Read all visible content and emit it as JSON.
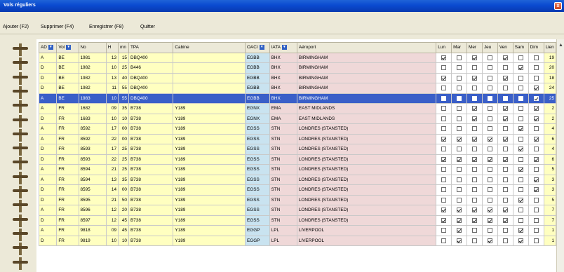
{
  "window": {
    "title": "Vols réguliers",
    "close_label": "x"
  },
  "menu": [
    {
      "label": "Ajouter (F2)"
    },
    {
      "label": "Supprimer (F4)"
    },
    {
      "label": "Enregistrer (F8)"
    },
    {
      "label": "Quitter"
    }
  ],
  "columns": {
    "ad": "AD",
    "vol": "Vol",
    "no": "No",
    "h": "H",
    "mn": "mn",
    "tpa": "TPA",
    "cabine": "Cabine",
    "oaci": "OACI",
    "iata": "IATA",
    "aeroport": "Aéroport",
    "lun": "Lun",
    "mar": "Mar",
    "mer": "Mer",
    "jeu": "Jeu",
    "ven": "Ven",
    "sam": "Sam",
    "dim": "Dim",
    "lien": "Lien"
  },
  "scroll_up_icon": "▲",
  "rows": [
    {
      "ad": "A",
      "vol": "BE",
      "no": "1981",
      "h": "13",
      "mn": "15",
      "tpa": "DBQ400",
      "cabine": "",
      "oaci": "EGBB",
      "iata": "BHX",
      "aeroport": "BIRMINGHAM",
      "days": [
        1,
        0,
        1,
        0,
        1,
        0,
        0
      ],
      "lien": "19",
      "selected": false
    },
    {
      "ad": "D",
      "vol": "BE",
      "no": "1982",
      "h": "10",
      "mn": "25",
      "tpa": "B446",
      "cabine": "",
      "oaci": "EGBB",
      "iata": "BHX",
      "aeroport": "BIRMINGHAM",
      "days": [
        0,
        0,
        0,
        0,
        0,
        1,
        0
      ],
      "lien": "20",
      "selected": false
    },
    {
      "ad": "D",
      "vol": "BE",
      "no": "1982",
      "h": "13",
      "mn": "40",
      "tpa": "DBQ400",
      "cabine": "",
      "oaci": "EGBB",
      "iata": "BHX",
      "aeroport": "BIRMINGHAM",
      "days": [
        1,
        0,
        1,
        0,
        1,
        0,
        0
      ],
      "lien": "18",
      "selected": false
    },
    {
      "ad": "D",
      "vol": "BE",
      "no": "1982",
      "h": "11",
      "mn": "55",
      "tpa": "DBQ400",
      "cabine": "",
      "oaci": "EGBB",
      "iata": "BHX",
      "aeroport": "BIRMINGHAM",
      "days": [
        0,
        0,
        0,
        0,
        0,
        0,
        1
      ],
      "lien": "24",
      "selected": false
    },
    {
      "ad": "A",
      "vol": "BE",
      "no": "1983",
      "h": "10",
      "mn": "55",
      "tpa": "DBQ400",
      "cabine": "",
      "oaci": "EGBB",
      "iata": "BHX",
      "aeroport": "BIRMINGHAM",
      "days": [
        0,
        0,
        0,
        0,
        0,
        0,
        1
      ],
      "lien": "25",
      "selected": true
    },
    {
      "ad": "A",
      "vol": "FR",
      "no": "1682",
      "h": "09",
      "mn": "35",
      "tpa": "B738",
      "cabine": "Y189",
      "oaci": "EGNX",
      "iata": "EMA",
      "aeroport": "EAST MIDLANDS",
      "days": [
        0,
        0,
        1,
        0,
        1,
        0,
        1
      ],
      "lien": "2",
      "selected": false
    },
    {
      "ad": "D",
      "vol": "FR",
      "no": "1683",
      "h": "10",
      "mn": "10",
      "tpa": "B738",
      "cabine": "Y189",
      "oaci": "EGNX",
      "iata": "EMA",
      "aeroport": "EAST MIDLANDS",
      "days": [
        0,
        0,
        1,
        0,
        1,
        0,
        1
      ],
      "lien": "2",
      "selected": false
    },
    {
      "ad": "A",
      "vol": "FR",
      "no": "8592",
      "h": "17",
      "mn": "00",
      "tpa": "B738",
      "cabine": "Y189",
      "oaci": "EGSS",
      "iata": "STN",
      "aeroport": "LONDRES (STANSTED)",
      "days": [
        0,
        0,
        0,
        0,
        0,
        1,
        0
      ],
      "lien": "4",
      "selected": false
    },
    {
      "ad": "A",
      "vol": "FR",
      "no": "8592",
      "h": "22",
      "mn": "00",
      "tpa": "B738",
      "cabine": "Y189",
      "oaci": "EGSS",
      "iata": "STN",
      "aeroport": "LONDRES (STANSTED)",
      "days": [
        1,
        1,
        1,
        1,
        1,
        0,
        1
      ],
      "lien": "6",
      "selected": false
    },
    {
      "ad": "D",
      "vol": "FR",
      "no": "8593",
      "h": "17",
      "mn": "25",
      "tpa": "B738",
      "cabine": "Y189",
      "oaci": "EGSS",
      "iata": "STN",
      "aeroport": "LONDRES (STANSTED)",
      "days": [
        0,
        0,
        0,
        0,
        0,
        1,
        0
      ],
      "lien": "4",
      "selected": false
    },
    {
      "ad": "D",
      "vol": "FR",
      "no": "8593",
      "h": "22",
      "mn": "25",
      "tpa": "B738",
      "cabine": "Y189",
      "oaci": "EGSS",
      "iata": "STN",
      "aeroport": "LONDRES (STANSTED)",
      "days": [
        1,
        1,
        1,
        1,
        1,
        0,
        1
      ],
      "lien": "6",
      "selected": false
    },
    {
      "ad": "A",
      "vol": "FR",
      "no": "8594",
      "h": "21",
      "mn": "25",
      "tpa": "B738",
      "cabine": "Y189",
      "oaci": "EGSS",
      "iata": "STN",
      "aeroport": "LONDRES (STANSTED)",
      "days": [
        0,
        0,
        0,
        0,
        0,
        1,
        0
      ],
      "lien": "5",
      "selected": false
    },
    {
      "ad": "A",
      "vol": "FR",
      "no": "8594",
      "h": "13",
      "mn": "35",
      "tpa": "B738",
      "cabine": "Y189",
      "oaci": "EGSS",
      "iata": "STN",
      "aeroport": "LONDRES (STANSTED)",
      "days": [
        0,
        0,
        0,
        0,
        0,
        0,
        1
      ],
      "lien": "3",
      "selected": false
    },
    {
      "ad": "D",
      "vol": "FR",
      "no": "8595",
      "h": "14",
      "mn": "00",
      "tpa": "B738",
      "cabine": "Y189",
      "oaci": "EGSS",
      "iata": "STN",
      "aeroport": "LONDRES (STANSTED)",
      "days": [
        0,
        0,
        0,
        0,
        0,
        0,
        1
      ],
      "lien": "3",
      "selected": false
    },
    {
      "ad": "D",
      "vol": "FR",
      "no": "8595",
      "h": "21",
      "mn": "50",
      "tpa": "B738",
      "cabine": "Y189",
      "oaci": "EGSS",
      "iata": "STN",
      "aeroport": "LONDRES (STANSTED)",
      "days": [
        0,
        0,
        0,
        0,
        0,
        1,
        0
      ],
      "lien": "5",
      "selected": false
    },
    {
      "ad": "A",
      "vol": "FR",
      "no": "8596",
      "h": "12",
      "mn": "20",
      "tpa": "B738",
      "cabine": "Y189",
      "oaci": "EGSS",
      "iata": "STN",
      "aeroport": "LONDRES (STANSTED)",
      "days": [
        1,
        1,
        1,
        1,
        1,
        0,
        0
      ],
      "lien": "7",
      "selected": false
    },
    {
      "ad": "D",
      "vol": "FR",
      "no": "8597",
      "h": "12",
      "mn": "45",
      "tpa": "B738",
      "cabine": "Y189",
      "oaci": "EGSS",
      "iata": "STN",
      "aeroport": "LONDRES (STANSTED)",
      "days": [
        1,
        1,
        1,
        1,
        1,
        0,
        0
      ],
      "lien": "7",
      "selected": false
    },
    {
      "ad": "A",
      "vol": "FR",
      "no": "9818",
      "h": "09",
      "mn": "45",
      "tpa": "B738",
      "cabine": "Y189",
      "oaci": "EGGP",
      "iata": "LPL",
      "aeroport": "LIVERPOOL",
      "days": [
        0,
        1,
        0,
        0,
        0,
        1,
        0
      ],
      "lien": "1",
      "selected": false
    },
    {
      "ad": "D",
      "vol": "FR",
      "no": "9819",
      "h": "10",
      "mn": "10",
      "tpa": "B738",
      "cabine": "Y189",
      "oaci": "EGGP",
      "iata": "LPL",
      "aeroport": "LIVERPOOL",
      "days": [
        0,
        1,
        0,
        1,
        0,
        1,
        0
      ],
      "lien": "1",
      "selected": false
    }
  ]
}
